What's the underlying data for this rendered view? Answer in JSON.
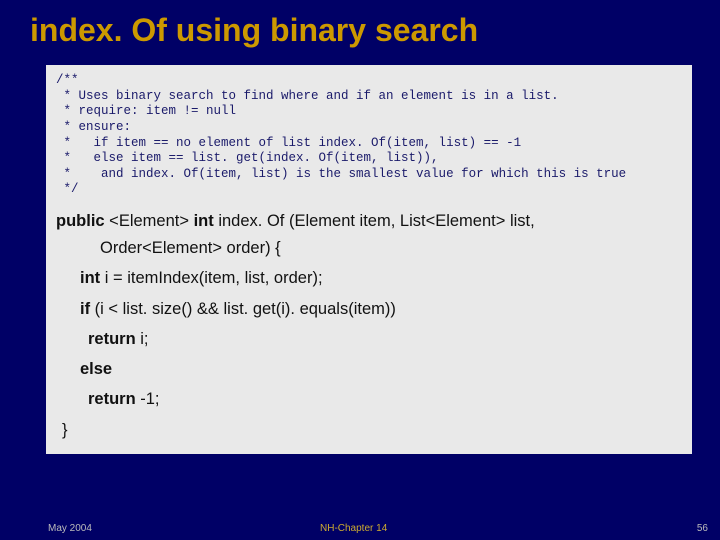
{
  "title": "index. Of using binary search",
  "comment": {
    "l1": "/**",
    "l2": " * Uses binary search to find where and if an element is in a list.",
    "l3": " * require: item != null",
    "l4": " * ensure:",
    "l5": " *   if item == no element of list index. Of(item, list) == -1",
    "l6": " *   else item == list. get(index. Of(item, list)),",
    "l7": " *    and index. Of(item, list) is the smallest value for which this is true",
    "l8": " */"
  },
  "code": {
    "kw_public": "public",
    "generic1": " <Element> ",
    "kw_int": "int",
    "sig_name": " index. Of (Element item,  List<Element> list,",
    "sig_cont": "Order<Element> order) {",
    "kw_int2": "int",
    "assign": " i = itemIndex(item, list, order);",
    "kw_if": "if",
    "cond": " (i < list. size() && list. get(i). equals(item))",
    "kw_return1": "return",
    "ret1": " i;",
    "kw_else": "else",
    "kw_return2": "return",
    "ret2": " -1;",
    "close": "}"
  },
  "footer": {
    "date": "May 2004",
    "chapter": "NH-Chapter 14",
    "page": "56"
  }
}
